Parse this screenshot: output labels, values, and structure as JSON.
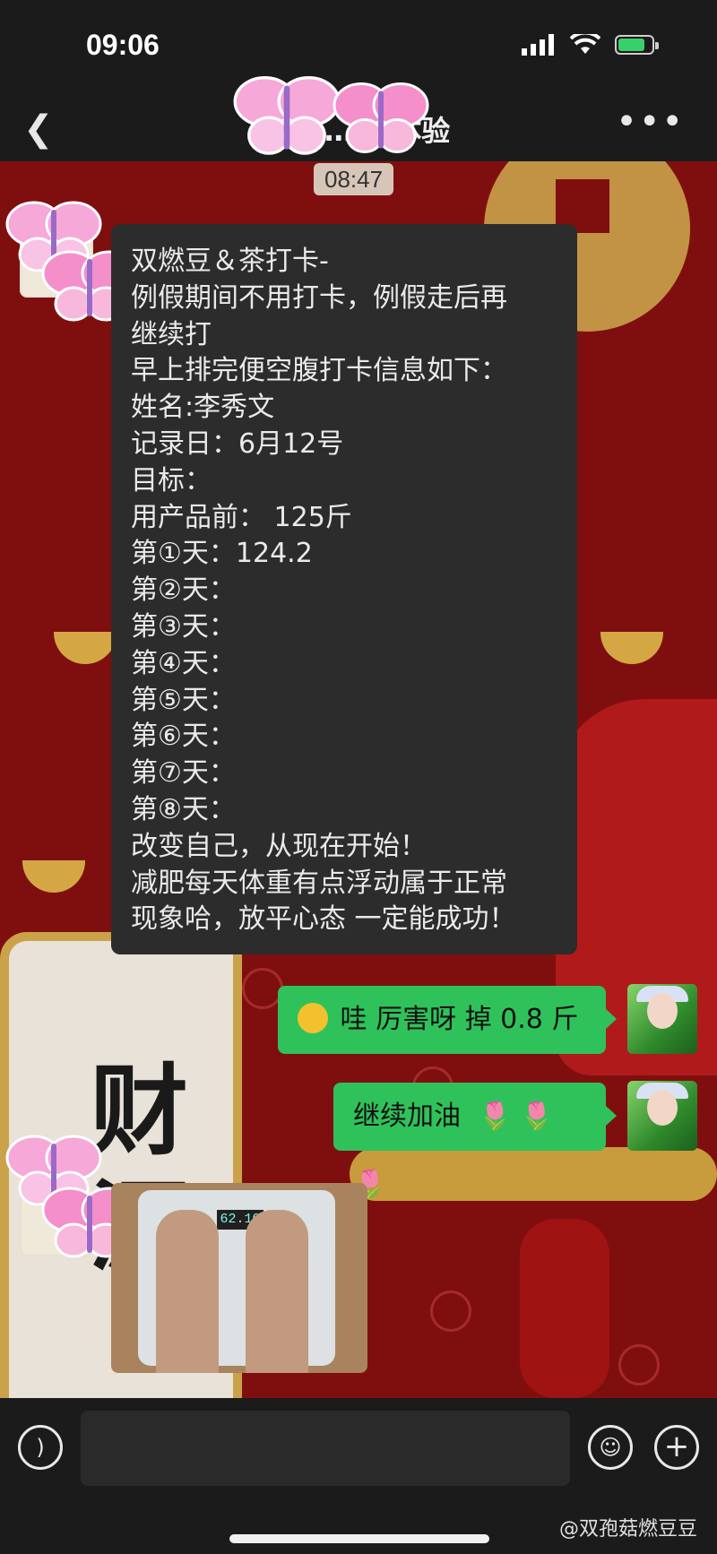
{
  "status_bar": {
    "time": "09:06"
  },
  "nav": {
    "title": "客户…59体验"
  },
  "chat": {
    "timestamp": "08:47",
    "main_message": {
      "lines": [
        "双燃豆＆茶打卡-",
        "例假期间不用打卡，例假走后再",
        "继续打",
        "早上排完便空腹打卡信息如下：",
        "姓名:李秀文",
        "记录日：6月12号",
        "目标：",
        "用产品前： 125斤",
        "第①天：124.2",
        "第②天：",
        "第③天：",
        "第④天：",
        "第⑤天：",
        "第⑥天：",
        "第⑦天：",
        "第⑧天：",
        "改变自己，从现在开始！",
        "减肥每天体重有点浮动属于正常",
        "现象哈，放平心态 一定能成功！"
      ]
    },
    "reply1": "哇 厉害呀 掉 0.8 斤",
    "reply2": "继续加油",
    "reply2_emojis": "🌷 🌷 🌷",
    "photo_scale_reading": "62.10"
  },
  "background_characters": [
    "财",
    "源"
  ],
  "footer": {
    "watermark": "@双孢菇燃豆豆"
  },
  "colors": {
    "chat_background": "#7f0f0f",
    "bubble_dark": "#2c2c2c",
    "bubble_green": "#2fc25b",
    "bar_dark": "#1b1b1b"
  },
  "icons": [
    "back-icon",
    "more-icon",
    "voice-icon",
    "emoji-icon",
    "plus-icon",
    "signal-icon",
    "wifi-icon",
    "battery-icon",
    "butterfly-sticker"
  ]
}
